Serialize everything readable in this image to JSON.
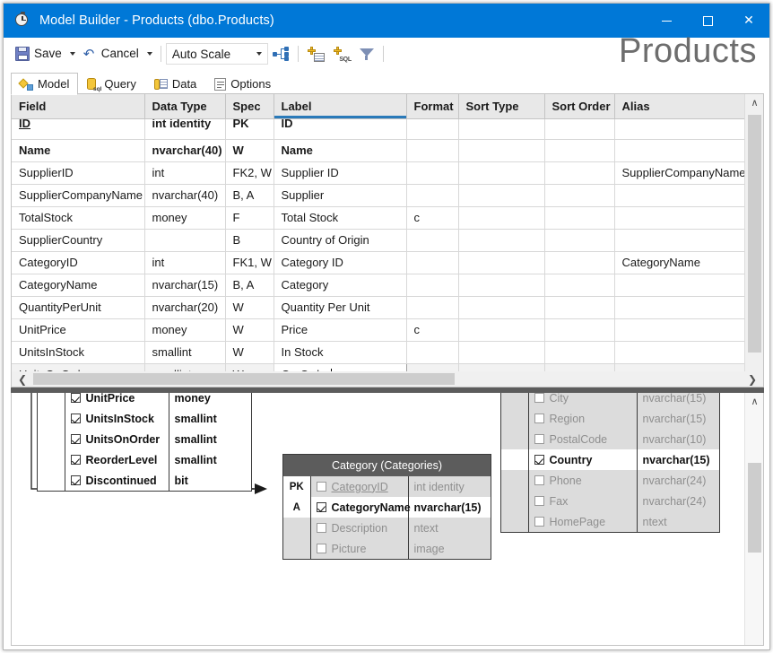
{
  "window": {
    "title": "Model Builder - Products (dbo.Products)",
    "icon": "clock-icon",
    "minimize": "–",
    "maximize": "□",
    "close": "✕"
  },
  "page_heading": "Products",
  "toolbar": {
    "save_label": "Save",
    "cancel_label": "Cancel",
    "scale_label": "Auto Scale",
    "hierarchy_icon": "hierarchy-icon",
    "new_table_icon": "add-table-icon",
    "new_sql_icon": "add-sql-icon",
    "filter_icon": "filter-icon",
    "sql_text": "SQL"
  },
  "tabs": [
    {
      "label": "Model",
      "icon": "model-icon",
      "active": true
    },
    {
      "label": "Query",
      "icon": "sql-query-icon",
      "active": false
    },
    {
      "label": "Data",
      "icon": "data-icon",
      "active": false
    },
    {
      "label": "Options",
      "icon": "options-icon",
      "active": false
    }
  ],
  "grid": {
    "columns": [
      "Field",
      "Data Type",
      "Spec",
      "Label",
      "Format",
      "Sort Type",
      "Sort Order",
      "Alias"
    ],
    "selected_column": "Label",
    "rows": [
      {
        "field": "ID",
        "type": "int identity",
        "spec": "PK",
        "label": "ID",
        "format": "",
        "sort_type": "",
        "sort_order": "",
        "alias": "",
        "bold": true,
        "underline": true,
        "partial": true
      },
      {
        "field": "Name",
        "type": "nvarchar(40)",
        "spec": "W",
        "label": "Name",
        "format": "",
        "sort_type": "",
        "sort_order": "",
        "alias": "",
        "bold": true
      },
      {
        "field": "SupplierID",
        "type": "int",
        "spec": "FK2, W",
        "label": "Supplier ID",
        "format": "",
        "sort_type": "",
        "sort_order": "",
        "alias": "SupplierCompanyName"
      },
      {
        "field": "SupplierCompanyName",
        "type": "nvarchar(40)",
        "spec": "B, A",
        "label": "Supplier",
        "format": "",
        "sort_type": "",
        "sort_order": "",
        "alias": ""
      },
      {
        "field": "TotalStock",
        "type": "money",
        "spec": "F",
        "label": "Total Stock",
        "format": "c",
        "sort_type": "",
        "sort_order": "",
        "alias": ""
      },
      {
        "field": "SupplierCountry",
        "type": "",
        "spec": "B",
        "label": "Country of Origin",
        "format": "",
        "sort_type": "",
        "sort_order": "",
        "alias": ""
      },
      {
        "field": "CategoryID",
        "type": "int",
        "spec": "FK1, W",
        "label": "Category ID",
        "format": "",
        "sort_type": "",
        "sort_order": "",
        "alias": "CategoryName"
      },
      {
        "field": "CategoryName",
        "type": "nvarchar(15)",
        "spec": "B, A",
        "label": "Category",
        "format": "",
        "sort_type": "",
        "sort_order": "",
        "alias": ""
      },
      {
        "field": "QuantityPerUnit",
        "type": "nvarchar(20)",
        "spec": "W",
        "label": "Quantity Per Unit",
        "format": "",
        "sort_type": "",
        "sort_order": "",
        "alias": ""
      },
      {
        "field": "UnitPrice",
        "type": "money",
        "spec": "W",
        "label": "Price",
        "format": "c",
        "sort_type": "",
        "sort_order": "",
        "alias": ""
      },
      {
        "field": "UnitsInStock",
        "type": "smallint",
        "spec": "W",
        "label": "In Stock",
        "format": "",
        "sort_type": "",
        "sort_order": "",
        "alias": ""
      },
      {
        "field": "UnitsOnOrder",
        "type": "smallint",
        "spec": "W",
        "label": "On Order",
        "format": "",
        "sort_type": "",
        "sort_order": "",
        "alias": "",
        "current": true,
        "editing_cell": "label"
      }
    ]
  },
  "diagram": {
    "products_entity": {
      "rows": [
        {
          "key": "",
          "name": "UnitPrice",
          "type": "money",
          "checked": true,
          "bold": false
        },
        {
          "key": "",
          "name": "UnitsInStock",
          "type": "smallint",
          "checked": true,
          "bold": false
        },
        {
          "key": "",
          "name": "UnitsOnOrder",
          "type": "smallint",
          "checked": true,
          "bold": false
        },
        {
          "key": "",
          "name": "ReorderLevel",
          "type": "smallint",
          "checked": true,
          "bold": false
        },
        {
          "key": "",
          "name": "Discontinued",
          "type": "bit",
          "checked": true,
          "bold": true
        }
      ]
    },
    "category_entity": {
      "title": "Category (Categories)",
      "rows": [
        {
          "key": "PK",
          "name": "CategoryID",
          "type": "int identity",
          "checked": false,
          "on": false,
          "underline": true
        },
        {
          "key": "A",
          "name": "CategoryName",
          "type": "nvarchar(15)",
          "checked": true,
          "on": true,
          "underline": false
        },
        {
          "key": "",
          "name": "Description",
          "type": "ntext",
          "checked": false,
          "on": false,
          "underline": false
        },
        {
          "key": "",
          "name": "Picture",
          "type": "image",
          "checked": false,
          "on": false,
          "underline": false
        }
      ]
    },
    "supplier_entity": {
      "rows": [
        {
          "key": "",
          "name": "City",
          "type": "nvarchar(15)",
          "checked": false,
          "on": false
        },
        {
          "key": "",
          "name": "Region",
          "type": "nvarchar(15)",
          "checked": false,
          "on": false
        },
        {
          "key": "",
          "name": "PostalCode",
          "type": "nvarchar(10)",
          "checked": false,
          "on": false
        },
        {
          "key": "",
          "name": "Country",
          "type": "nvarchar(15)",
          "checked": true,
          "on": true
        },
        {
          "key": "",
          "name": "Phone",
          "type": "nvarchar(24)",
          "checked": false,
          "on": false
        },
        {
          "key": "",
          "name": "Fax",
          "type": "nvarchar(24)",
          "checked": false,
          "on": false
        },
        {
          "key": "",
          "name": "HomePage",
          "type": "ntext",
          "checked": false,
          "on": false
        }
      ]
    }
  },
  "scrollbars": {
    "up_arrow": "∧",
    "down_arrow": "∨",
    "left_arrow": "❮",
    "right_arrow": "❯"
  },
  "colors": {
    "titlebar": "#0078d7",
    "accent": "#2a7ab9",
    "header_bg": "#e8e8e8",
    "entity_header": "#5c5c5c"
  }
}
